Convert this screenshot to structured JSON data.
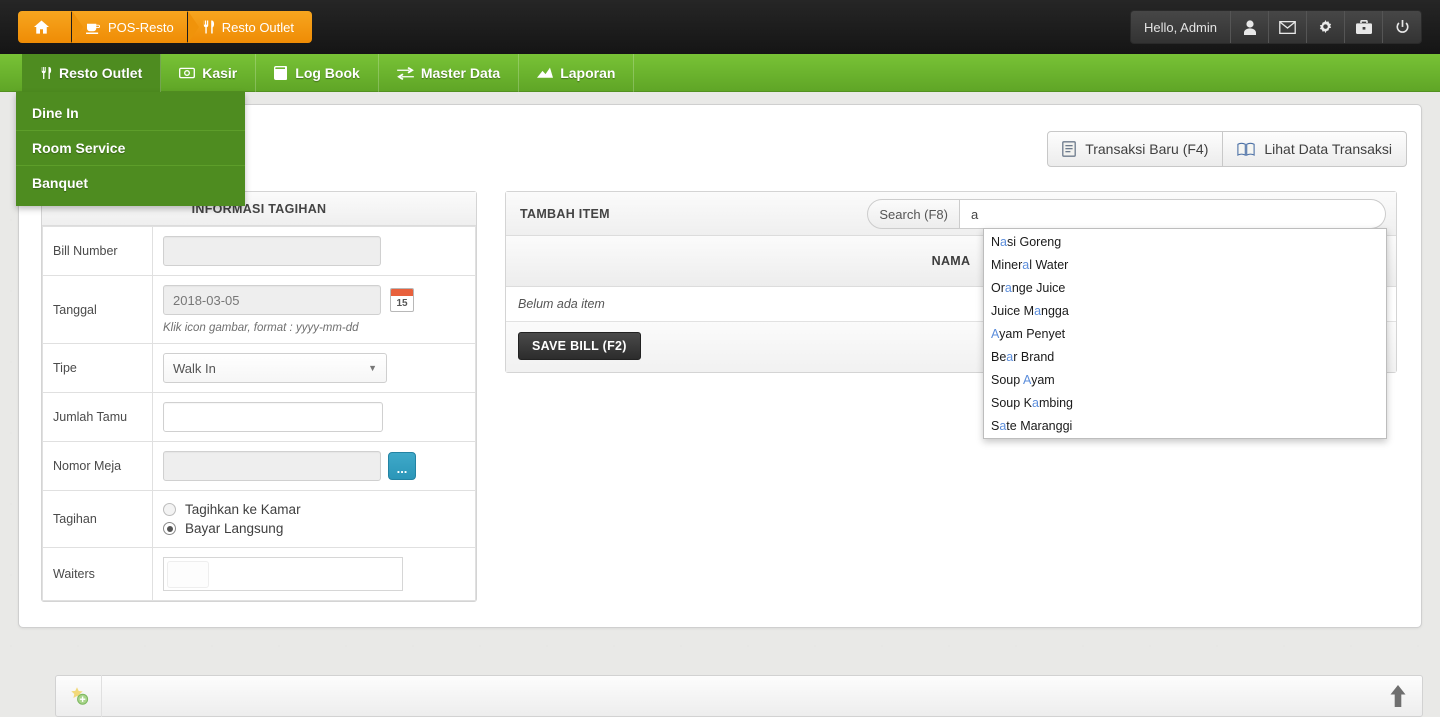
{
  "header": {
    "breadcrumb": [
      {
        "label": "",
        "icon": "home-icon"
      },
      {
        "label": "POS-Resto",
        "icon": "coffee-icon"
      },
      {
        "label": "Resto Outlet",
        "icon": "cutlery-icon"
      }
    ],
    "greeting": "Hello, Admin",
    "icons": [
      "user-icon",
      "envelope-icon",
      "gear-icon",
      "briefcase-icon",
      "power-icon"
    ]
  },
  "nav": {
    "items": [
      {
        "label": "Resto Outlet",
        "icon": "cutlery-icon",
        "active": true
      },
      {
        "label": "Kasir",
        "icon": "cash-icon",
        "active": false
      },
      {
        "label": "Log Book",
        "icon": "book-icon",
        "active": false
      },
      {
        "label": "Master Data",
        "icon": "exchange-icon",
        "active": false
      },
      {
        "label": "Laporan",
        "icon": "chart-icon",
        "active": false
      }
    ],
    "dropdown": [
      {
        "label": "Dine In"
      },
      {
        "label": "Room Service"
      },
      {
        "label": "Banquet"
      }
    ]
  },
  "toolbar": {
    "new_transaction": "Transaksi Baru (F4)",
    "view_transactions": "Lihat Data Transaksi"
  },
  "bill_panel": {
    "title": "INFORMASI TAGIHAN",
    "fields": {
      "bill_number_label": "Bill Number",
      "bill_number_value": "",
      "tanggal_label": "Tanggal",
      "tanggal_value": "2018-03-05",
      "tanggal_hint": "Klik icon gambar, format : yyyy-mm-dd",
      "calendar_day": "15",
      "tipe_label": "Tipe",
      "tipe_value": "Walk In",
      "jumlah_tamu_label": "Jumlah Tamu",
      "jumlah_tamu_value": "",
      "nomor_meja_label": "Nomor Meja",
      "nomor_meja_value": "",
      "nomor_meja_button": "...",
      "tagihan_label": "Tagihan",
      "tagihan_option_1": "Tagihkan ke Kamar",
      "tagihan_option_2": "Bayar Langsung",
      "tagihan_selected": "Bayar Langsung",
      "waiters_label": "Waiters",
      "waiters_value": ""
    }
  },
  "item_panel": {
    "title": "TAMBAH ITEM",
    "search_prefix": "Search (F8)",
    "search_value": "a",
    "search_placeholder": "",
    "table_header": "NAMA",
    "empty_row": "Belum ada item",
    "save_button": "SAVE BILL (F2)"
  },
  "autocomplete": {
    "query": "a",
    "items": [
      {
        "pre": "N",
        "match": "a",
        "post": "si Goreng",
        "full": "Nasi Goreng"
      },
      {
        "pre": "Miner",
        "match": "a",
        "post": "l Water",
        "full": "Mineral Water"
      },
      {
        "pre": "Or",
        "match": "a",
        "post": "nge Juice",
        "full": "Orange Juice"
      },
      {
        "pre": "Juice M",
        "match": "a",
        "post": "ngga",
        "full": "Juice Mangga"
      },
      {
        "pre": "",
        "match": "A",
        "post": "yam Penyet",
        "full": "Ayam Penyet"
      },
      {
        "pre": "Be",
        "match": "a",
        "post": "r Brand",
        "full": "Bear Brand"
      },
      {
        "pre": "Soup ",
        "match": "A",
        "post": "yam",
        "full": "Soup Ayam"
      },
      {
        "pre": "Soup K",
        "match": "a",
        "post": "mbing",
        "full": "Soup Kambing"
      },
      {
        "pre": "S",
        "match": "a",
        "post": "te Maranggi",
        "full": "Sate Maranggi"
      }
    ]
  },
  "footer": {
    "left_icon": "star-plus-icon",
    "scroll_top_icon": "arrow-up-icon"
  },
  "colors": {
    "brand_green": "#6ab42c",
    "active_green": "#4e8c20",
    "breadcrumb_orange": "#f0930a",
    "topbar_black": "#1c1c1c",
    "accent_blue": "#2b96b8",
    "highlight_blue": "#5b8ddb"
  }
}
